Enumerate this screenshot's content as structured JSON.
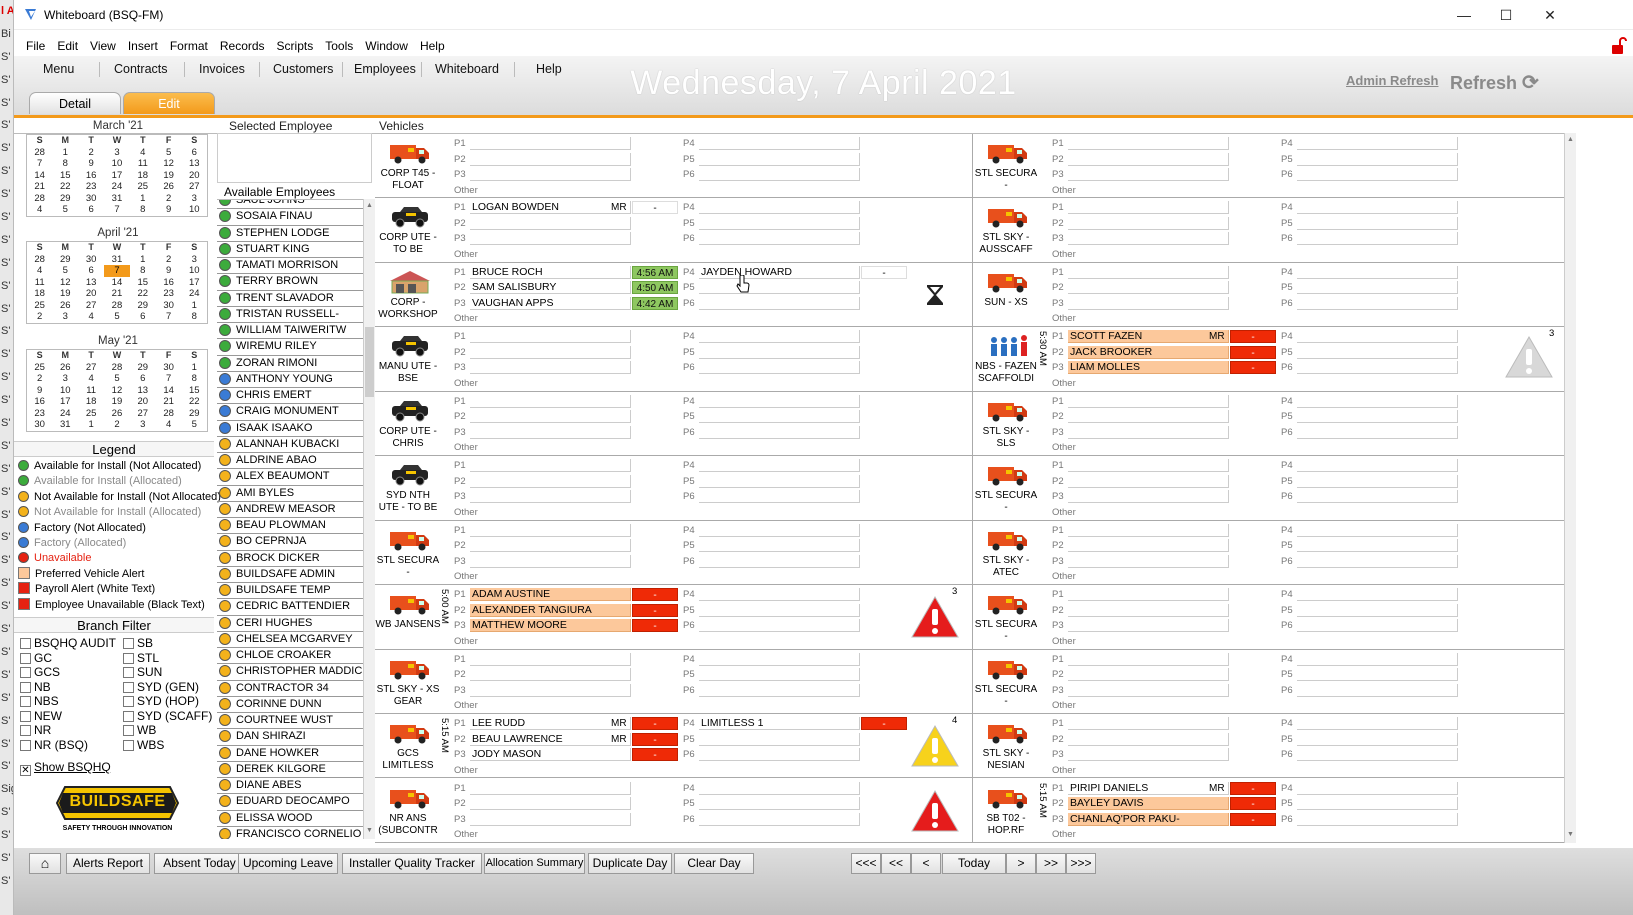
{
  "window": {
    "title": "Whiteboard (BSQ-FM)"
  },
  "bg_strip": [
    "l A",
    "Bi",
    "S'",
    "S'",
    "S'",
    "S'",
    "S'",
    "S'",
    "S'",
    "S'",
    "S'",
    "S'",
    "S'",
    "S'",
    "S'",
    "S'",
    "S'",
    "S'",
    "S'",
    "S'",
    "S'",
    "S'",
    "S'",
    "S'",
    "S'",
    "S'",
    "S'",
    "S'",
    "S'",
    "S'",
    "S'",
    "S'",
    "S'",
    "S'",
    "Sig",
    "S'",
    "S'",
    "S'",
    "S'"
  ],
  "menu": [
    "File",
    "Edit",
    "View",
    "Insert",
    "Format",
    "Records",
    "Scripts",
    "Tools",
    "Window",
    "Help"
  ],
  "nav": [
    "Menu",
    "Contracts",
    "Invoices",
    "Customers",
    "Employees",
    "Whiteboard",
    "Help"
  ],
  "date_title": "Wednesday, 7 April 2021",
  "admin_refresh": "Admin Refresh",
  "refresh": "Refresh",
  "tabs": [
    "Detail",
    "Edit"
  ],
  "panels": {
    "selected_employee": "Selected Employee",
    "vehicles": "Vehicles",
    "available_employees": "Available Employees"
  },
  "calendars": [
    {
      "title": "March '21",
      "days": [
        "S",
        "M",
        "T",
        "W",
        "T",
        "F",
        "S"
      ],
      "weeks": [
        [
          "28",
          "1",
          "2",
          "3",
          "4",
          "5",
          "6"
        ],
        [
          "7",
          "8",
          "9",
          "10",
          "11",
          "12",
          "13"
        ],
        [
          "14",
          "15",
          "16",
          "17",
          "18",
          "19",
          "20"
        ],
        [
          "21",
          "22",
          "23",
          "24",
          "25",
          "26",
          "27"
        ],
        [
          "28",
          "29",
          "30",
          "31",
          "1",
          "2",
          "3"
        ],
        [
          "4",
          "5",
          "6",
          "7",
          "8",
          "9",
          "10"
        ]
      ]
    },
    {
      "title": "April '21",
      "days": [
        "S",
        "M",
        "T",
        "W",
        "T",
        "F",
        "S"
      ],
      "weeks": [
        [
          "28",
          "29",
          "30",
          "31",
          "1",
          "2",
          "3"
        ],
        [
          "4",
          "5",
          "6",
          "7",
          "8",
          "9",
          "10"
        ],
        [
          "11",
          "12",
          "13",
          "14",
          "15",
          "16",
          "17"
        ],
        [
          "18",
          "19",
          "20",
          "21",
          "22",
          "23",
          "24"
        ],
        [
          "25",
          "26",
          "27",
          "28",
          "29",
          "30",
          "1"
        ],
        [
          "2",
          "3",
          "4",
          "5",
          "6",
          "7",
          "8"
        ]
      ]
    },
    {
      "title": "May '21",
      "days": [
        "S",
        "M",
        "T",
        "W",
        "T",
        "F",
        "S"
      ],
      "weeks": [
        [
          "25",
          "26",
          "27",
          "28",
          "29",
          "30",
          "1"
        ],
        [
          "2",
          "3",
          "4",
          "5",
          "6",
          "7",
          "8"
        ],
        [
          "9",
          "10",
          "11",
          "12",
          "13",
          "14",
          "15"
        ],
        [
          "16",
          "17",
          "18",
          "19",
          "20",
          "21",
          "22"
        ],
        [
          "23",
          "24",
          "25",
          "26",
          "27",
          "28",
          "29"
        ],
        [
          "30",
          "31",
          "1",
          "2",
          "3",
          "4",
          "5"
        ]
      ]
    }
  ],
  "legend": {
    "title": "Legend",
    "items": [
      {
        "label": "Available for Install (Not Allocated)",
        "kind": "dot",
        "color": "#3cab3c",
        "text_color": "#000000"
      },
      {
        "label": "Available for Install (Allocated)",
        "kind": "dot",
        "color": "#3cab3c",
        "text_color": "#8a8a8a"
      },
      {
        "label": "Not Available for Install (Not Allocated)",
        "kind": "dot",
        "color": "#f3b21b",
        "text_color": "#000000"
      },
      {
        "label": "Not Available for Install (Allocated)",
        "kind": "dot",
        "color": "#f3b21b",
        "text_color": "#8a8a8a"
      },
      {
        "label": "Factory (Not Allocated)",
        "kind": "dot",
        "color": "#3a7bd5",
        "text_color": "#000000"
      },
      {
        "label": "Factory (Allocated)",
        "kind": "dot",
        "color": "#3a7bd5",
        "text_color": "#8a8a8a"
      },
      {
        "label": "Unavailable",
        "kind": "dot",
        "color": "#e52212",
        "text_color": "#e52212"
      },
      {
        "label": "Preferred Vehicle Alert",
        "kind": "sq",
        "color": "#fcc89b",
        "text_color": "#000000"
      },
      {
        "label": "Payroll Alert (White Text)",
        "kind": "sq",
        "color": "#e52212",
        "text_color": "#000000"
      },
      {
        "label": "Employee Unavailable (Black Text)",
        "kind": "sq",
        "color": "#e52212",
        "text_color": "#000000"
      }
    ]
  },
  "branch_filter": {
    "title": "Branch Filter",
    "left": [
      "BSQHQ AUDIT",
      "GC",
      "GCS",
      "NB",
      "NBS",
      "NEW",
      "NR",
      "NR (BSQ)"
    ],
    "right": [
      "SB",
      "STL",
      "SUN",
      "SYD (GEN)",
      "SYD (HOP)",
      "SYD (SCAFF)",
      "WB",
      "WBS"
    ],
    "show_label": "Show BSQHQ",
    "show_checked": true
  },
  "logo": {
    "name": "BUILDSAFE",
    "tagline": "SAFETY THROUGH INNOVATION"
  },
  "employees": [
    {
      "name": "SAUL JOHNS",
      "status": "green"
    },
    {
      "name": "SOSAIA FINAU",
      "status": "green"
    },
    {
      "name": "STEPHEN LODGE",
      "status": "green"
    },
    {
      "name": "STUART KING",
      "status": "green"
    },
    {
      "name": "TAMATI MORRISON",
      "status": "green"
    },
    {
      "name": "TERRY BROWN",
      "status": "green"
    },
    {
      "name": "TRENT SLAVADOR",
      "status": "green"
    },
    {
      "name": "TRISTAN RUSSELL-",
      "status": "green"
    },
    {
      "name": "WILLIAM TAIWERITW",
      "status": "green"
    },
    {
      "name": "WIREMU RILEY",
      "status": "green"
    },
    {
      "name": "ZORAN RIMONI",
      "status": "green"
    },
    {
      "name": "ANTHONY YOUNG",
      "status": "blue"
    },
    {
      "name": "CHRIS EMERT",
      "status": "blue"
    },
    {
      "name": "CRAIG MONUMENT",
      "status": "blue"
    },
    {
      "name": "ISAAK ISAAKO",
      "status": "blue"
    },
    {
      "name": "ALANNAH KUBACKI",
      "status": "orange"
    },
    {
      "name": "ALDRINE ABAO",
      "status": "orange"
    },
    {
      "name": "ALEX BEAUMONT",
      "status": "orange"
    },
    {
      "name": "AMI BYLES",
      "status": "orange"
    },
    {
      "name": "ANDREW MEASOR",
      "status": "orange"
    },
    {
      "name": "BEAU PLOWMAN",
      "status": "orange"
    },
    {
      "name": "BO CEPRNJA",
      "status": "orange"
    },
    {
      "name": "BROCK DICKER",
      "status": "orange"
    },
    {
      "name": "BUILDSAFE ADMIN",
      "status": "orange"
    },
    {
      "name": "BUILDSAFE TEMP",
      "status": "orange"
    },
    {
      "name": "CEDRIC BATTENDIER",
      "status": "orange"
    },
    {
      "name": "CERI HUGHES",
      "status": "orange"
    },
    {
      "name": "CHELSEA MCGARVEY",
      "status": "orange"
    },
    {
      "name": "CHLOE CROAKER",
      "status": "orange"
    },
    {
      "name": "CHRISTOPHER MADDICK",
      "status": "orange"
    },
    {
      "name": "CONTRACTOR 34",
      "status": "orange"
    },
    {
      "name": "CORINNE DUNN",
      "status": "orange"
    },
    {
      "name": "COURTNEE WUST",
      "status": "orange"
    },
    {
      "name": "DAN SHIRAZI",
      "status": "orange"
    },
    {
      "name": "DANE HOWKER",
      "status": "orange"
    },
    {
      "name": "DEREK KILGORE",
      "status": "orange"
    },
    {
      "name": "DIANE ABES",
      "status": "orange"
    },
    {
      "name": "EDUARD DEOCAMPO",
      "status": "orange"
    },
    {
      "name": "ELISSA WOOD",
      "status": "orange"
    },
    {
      "name": "FRANCISCO CORNELIO",
      "status": "orange"
    }
  ],
  "colors": {
    "accent": "#f39a1b",
    "pref": "#fcc89b",
    "alert_red": "#ef2a06",
    "time_green": "#8ec760"
  },
  "pos_labels": {
    "left": [
      "P1",
      "P2",
      "P3",
      "Other"
    ],
    "right": [
      "P4",
      "P5",
      "P6"
    ]
  },
  "vehicles": [
    {
      "col": 0,
      "row": 0,
      "name": "CORP T45 - FLOAT",
      "icon": "truck-icon"
    },
    {
      "col": 1,
      "row": 0,
      "name": "STL SECURA -",
      "icon": "truck-icon"
    },
    {
      "col": 0,
      "row": 1,
      "name": "CORP UTE - TO BE",
      "icon": "ute-icon",
      "p": [
        {
          "slot": 1,
          "name": "LOGAN BOWDEN",
          "mr": "MR",
          "stat": "-",
          "stat_kind": "plain"
        }
      ]
    },
    {
      "col": 1,
      "row": 1,
      "name": "STL SKY - AUSSCAFF",
      "icon": "truck-icon"
    },
    {
      "col": 0,
      "row": 2,
      "name": "CORP - WORKSHOP",
      "icon": "workshop-icon",
      "indicator": "hourglass-icon",
      "p": [
        {
          "slot": 1,
          "name": "BRUCE ROCH",
          "stat": "4:56 AM",
          "stat_kind": "green"
        },
        {
          "slot": 2,
          "name": "SAM SALISBURY",
          "stat": "4:50 AM",
          "stat_kind": "green"
        },
        {
          "slot": 3,
          "name": "VAUGHAN APPS",
          "stat": "4:42 AM",
          "stat_kind": "green"
        },
        {
          "slot": 4,
          "name": "JAYDEN HOWARD",
          "stat": "-",
          "stat_kind": "plain"
        }
      ]
    },
    {
      "col": 1,
      "row": 2,
      "name": "SUN - XS",
      "icon": "truck-icon"
    },
    {
      "col": 0,
      "row": 3,
      "name": "MANU UTE - BSE",
      "icon": "ute-icon"
    },
    {
      "col": 1,
      "row": 3,
      "name": "NBS - FAZEN SCAFFOLDI",
      "icon": "people-icon",
      "start": "5:30 AM",
      "count": "3",
      "indicator": "warning-grey-icon",
      "p": [
        {
          "slot": 1,
          "name": "SCOTT FAZEN",
          "mr": "MR",
          "stat": "-",
          "stat_kind": "red",
          "pref": true
        },
        {
          "slot": 2,
          "name": "JACK BROOKER",
          "stat": "-",
          "stat_kind": "red",
          "pref": true
        },
        {
          "slot": 3,
          "name": "LIAM MOLLES",
          "stat": "-",
          "stat_kind": "red",
          "pref": true
        }
      ]
    },
    {
      "col": 0,
      "row": 4,
      "name": "CORP UTE - CHRIS",
      "icon": "ute-icon"
    },
    {
      "col": 1,
      "row": 4,
      "name": "STL SKY - SLS",
      "icon": "truck-icon"
    },
    {
      "col": 0,
      "row": 5,
      "name": "SYD NTH UTE - TO BE",
      "icon": "ute-icon"
    },
    {
      "col": 1,
      "row": 5,
      "name": "STL SECURA -",
      "icon": "truck-icon"
    },
    {
      "col": 0,
      "row": 6,
      "name": "STL SECURA -",
      "icon": "truck-icon"
    },
    {
      "col": 1,
      "row": 6,
      "name": "STL SKY - ATEC",
      "icon": "truck-icon"
    },
    {
      "col": 0,
      "row": 7,
      "name": "WB JANSENS",
      "icon": "truck-icon",
      "start": "5:00 AM",
      "count": "3",
      "indicator": "warning-red-icon",
      "p": [
        {
          "slot": 1,
          "name": "ADAM AUSTINE",
          "stat": "-",
          "stat_kind": "red",
          "pref": true
        },
        {
          "slot": 2,
          "name": "ALEXANDER TANGIURA",
          "stat": "-",
          "stat_kind": "red",
          "pref": true
        },
        {
          "slot": 3,
          "name": "MATTHEW MOORE",
          "stat": "-",
          "stat_kind": "red",
          "pref": true
        }
      ]
    },
    {
      "col": 1,
      "row": 7,
      "name": "STL SECURA -",
      "icon": "truck-icon"
    },
    {
      "col": 0,
      "row": 8,
      "name": "STL SKY - XS GEAR",
      "icon": "truck-icon"
    },
    {
      "col": 1,
      "row": 8,
      "name": "STL SECURA -",
      "icon": "truck-icon"
    },
    {
      "col": 0,
      "row": 9,
      "name": "GCS LIMITLESS",
      "icon": "truck-icon",
      "start": "5:15 AM",
      "count": "4",
      "indicator": "warning-yellow-icon",
      "p": [
        {
          "slot": 1,
          "name": "LEE RUDD",
          "mr": "MR",
          "stat": "-",
          "stat_kind": "red"
        },
        {
          "slot": 2,
          "name": "BEAU LAWRENCE",
          "mr": "MR",
          "stat": "-",
          "stat_kind": "red"
        },
        {
          "slot": 3,
          "name": "JODY MASON",
          "stat": "-",
          "stat_kind": "red"
        },
        {
          "slot": 4,
          "name": "LIMITLESS 1",
          "stat": "-",
          "stat_kind": "red"
        }
      ]
    },
    {
      "col": 1,
      "row": 9,
      "name": "STL SKY - NESIAN",
      "icon": "truck-icon"
    },
    {
      "col": 0,
      "row": 10,
      "name": "NR ANS (SUBCONTR",
      "icon": "truck-icon",
      "indicator": "warning-red-icon"
    },
    {
      "col": 1,
      "row": 10,
      "name": "SB T02 - HOP.RF",
      "icon": "truck-icon",
      "start": "5:15 AM",
      "p": [
        {
          "slot": 1,
          "name": "PIRIPI DANIELS",
          "mr": "MR",
          "stat": "-",
          "stat_kind": "red"
        },
        {
          "slot": 2,
          "name": "BAYLEY DAVIS",
          "stat": "-",
          "stat_kind": "red",
          "pref": true
        },
        {
          "slot": 3,
          "name": "CHANLAQ'POR PAKU-",
          "stat": "-",
          "stat_kind": "red",
          "pref": true
        }
      ]
    }
  ],
  "bottom_buttons": [
    "Alerts Report",
    "Absent Today",
    "Upcoming Leave",
    "Installer Quality Tracker",
    "Allocation Summary",
    "Duplicate Day",
    "Clear Day"
  ],
  "nav_buttons": [
    "<<<",
    "<<",
    "<",
    "Today",
    ">",
    ">>",
    ">>>"
  ]
}
